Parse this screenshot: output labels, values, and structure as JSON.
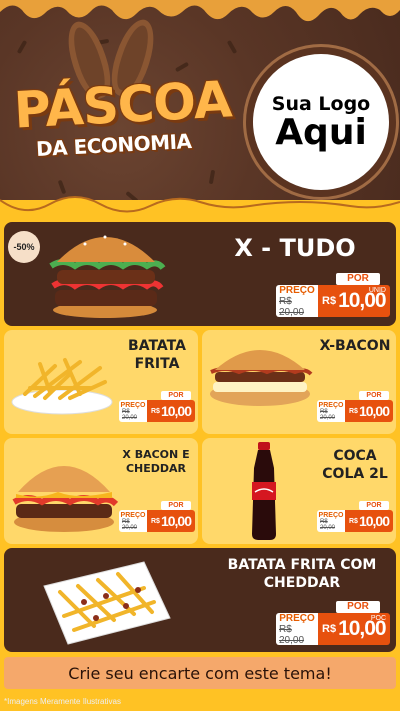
{
  "header": {
    "title_line1": "PÁSCOA",
    "title_line2": "DA ECONOMIA",
    "logo_line1": "Sua Logo",
    "logo_line2": "Aqui"
  },
  "badge": "-50%",
  "products": [
    {
      "name": "X - TUDO",
      "por": "POR",
      "preco_label": "PREÇO",
      "old": "R$ 20,00",
      "rs": "R$",
      "price": "10,00",
      "unit": "UNID"
    },
    {
      "name": "BATATA FRITA",
      "por": "POR",
      "preco_label": "PREÇO",
      "old": "R$ 20,00",
      "rs": "R$",
      "price": "10,00"
    },
    {
      "name": "X-BACON",
      "por": "POR",
      "preco_label": "PREÇO",
      "old": "R$ 20,00",
      "rs": "R$",
      "price": "10,00"
    },
    {
      "name": "X BACON E CHEDDAR",
      "por": "POR",
      "preco_label": "PREÇO",
      "old": "R$ 20,00",
      "rs": "R$",
      "price": "10,00"
    },
    {
      "name": "COCA COLA 2L",
      "por": "POR",
      "preco_label": "PREÇO",
      "old": "R$ 20,00",
      "rs": "R$",
      "price": "10,00"
    },
    {
      "name": "BATATA FRITA COM CHEDDAR",
      "por": "POR",
      "preco_label": "PREÇO",
      "old": "R$ 20,00",
      "rs": "R$",
      "price": "10,00",
      "unit": "POC"
    }
  ],
  "cta": "Crie seu encarte com este tema!",
  "footnote": "*Imagens Meramente Ilustrativas",
  "colors": {
    "brown": "#4a2a1c",
    "yellow": "#ffc224",
    "orange": "#e7510e",
    "title": "#ffb64a"
  }
}
